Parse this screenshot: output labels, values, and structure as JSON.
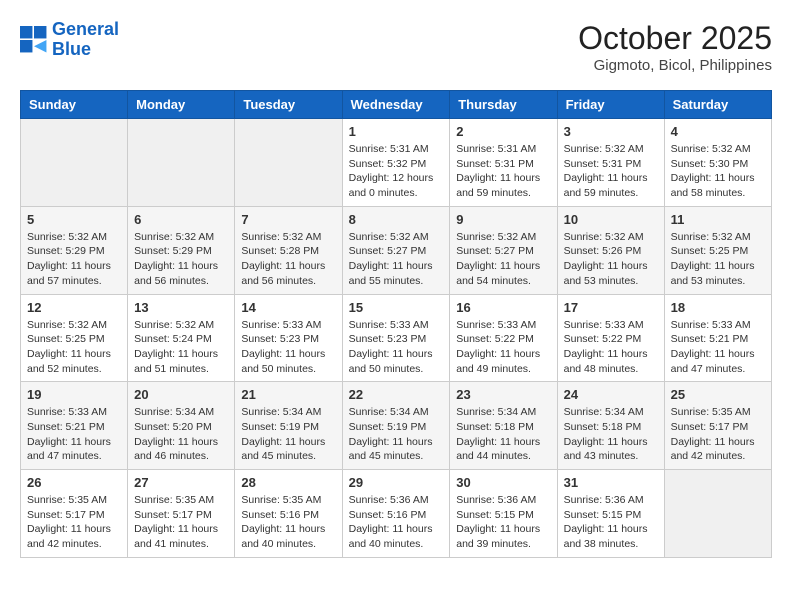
{
  "header": {
    "logo_line1": "General",
    "logo_line2": "Blue",
    "month": "October 2025",
    "location": "Gigmoto, Bicol, Philippines"
  },
  "weekdays": [
    "Sunday",
    "Monday",
    "Tuesday",
    "Wednesday",
    "Thursday",
    "Friday",
    "Saturday"
  ],
  "weeks": [
    [
      {
        "day": "",
        "info": ""
      },
      {
        "day": "",
        "info": ""
      },
      {
        "day": "",
        "info": ""
      },
      {
        "day": "1",
        "info": "Sunrise: 5:31 AM\nSunset: 5:32 PM\nDaylight: 12 hours and 0 minutes."
      },
      {
        "day": "2",
        "info": "Sunrise: 5:31 AM\nSunset: 5:31 PM\nDaylight: 11 hours and 59 minutes."
      },
      {
        "day": "3",
        "info": "Sunrise: 5:32 AM\nSunset: 5:31 PM\nDaylight: 11 hours and 59 minutes."
      },
      {
        "day": "4",
        "info": "Sunrise: 5:32 AM\nSunset: 5:30 PM\nDaylight: 11 hours and 58 minutes."
      }
    ],
    [
      {
        "day": "5",
        "info": "Sunrise: 5:32 AM\nSunset: 5:29 PM\nDaylight: 11 hours and 57 minutes."
      },
      {
        "day": "6",
        "info": "Sunrise: 5:32 AM\nSunset: 5:29 PM\nDaylight: 11 hours and 56 minutes."
      },
      {
        "day": "7",
        "info": "Sunrise: 5:32 AM\nSunset: 5:28 PM\nDaylight: 11 hours and 56 minutes."
      },
      {
        "day": "8",
        "info": "Sunrise: 5:32 AM\nSunset: 5:27 PM\nDaylight: 11 hours and 55 minutes."
      },
      {
        "day": "9",
        "info": "Sunrise: 5:32 AM\nSunset: 5:27 PM\nDaylight: 11 hours and 54 minutes."
      },
      {
        "day": "10",
        "info": "Sunrise: 5:32 AM\nSunset: 5:26 PM\nDaylight: 11 hours and 53 minutes."
      },
      {
        "day": "11",
        "info": "Sunrise: 5:32 AM\nSunset: 5:25 PM\nDaylight: 11 hours and 53 minutes."
      }
    ],
    [
      {
        "day": "12",
        "info": "Sunrise: 5:32 AM\nSunset: 5:25 PM\nDaylight: 11 hours and 52 minutes."
      },
      {
        "day": "13",
        "info": "Sunrise: 5:32 AM\nSunset: 5:24 PM\nDaylight: 11 hours and 51 minutes."
      },
      {
        "day": "14",
        "info": "Sunrise: 5:33 AM\nSunset: 5:23 PM\nDaylight: 11 hours and 50 minutes."
      },
      {
        "day": "15",
        "info": "Sunrise: 5:33 AM\nSunset: 5:23 PM\nDaylight: 11 hours and 50 minutes."
      },
      {
        "day": "16",
        "info": "Sunrise: 5:33 AM\nSunset: 5:22 PM\nDaylight: 11 hours and 49 minutes."
      },
      {
        "day": "17",
        "info": "Sunrise: 5:33 AM\nSunset: 5:22 PM\nDaylight: 11 hours and 48 minutes."
      },
      {
        "day": "18",
        "info": "Sunrise: 5:33 AM\nSunset: 5:21 PM\nDaylight: 11 hours and 47 minutes."
      }
    ],
    [
      {
        "day": "19",
        "info": "Sunrise: 5:33 AM\nSunset: 5:21 PM\nDaylight: 11 hours and 47 minutes."
      },
      {
        "day": "20",
        "info": "Sunrise: 5:34 AM\nSunset: 5:20 PM\nDaylight: 11 hours and 46 minutes."
      },
      {
        "day": "21",
        "info": "Sunrise: 5:34 AM\nSunset: 5:19 PM\nDaylight: 11 hours and 45 minutes."
      },
      {
        "day": "22",
        "info": "Sunrise: 5:34 AM\nSunset: 5:19 PM\nDaylight: 11 hours and 45 minutes."
      },
      {
        "day": "23",
        "info": "Sunrise: 5:34 AM\nSunset: 5:18 PM\nDaylight: 11 hours and 44 minutes."
      },
      {
        "day": "24",
        "info": "Sunrise: 5:34 AM\nSunset: 5:18 PM\nDaylight: 11 hours and 43 minutes."
      },
      {
        "day": "25",
        "info": "Sunrise: 5:35 AM\nSunset: 5:17 PM\nDaylight: 11 hours and 42 minutes."
      }
    ],
    [
      {
        "day": "26",
        "info": "Sunrise: 5:35 AM\nSunset: 5:17 PM\nDaylight: 11 hours and 42 minutes."
      },
      {
        "day": "27",
        "info": "Sunrise: 5:35 AM\nSunset: 5:17 PM\nDaylight: 11 hours and 41 minutes."
      },
      {
        "day": "28",
        "info": "Sunrise: 5:35 AM\nSunset: 5:16 PM\nDaylight: 11 hours and 40 minutes."
      },
      {
        "day": "29",
        "info": "Sunrise: 5:36 AM\nSunset: 5:16 PM\nDaylight: 11 hours and 40 minutes."
      },
      {
        "day": "30",
        "info": "Sunrise: 5:36 AM\nSunset: 5:15 PM\nDaylight: 11 hours and 39 minutes."
      },
      {
        "day": "31",
        "info": "Sunrise: 5:36 AM\nSunset: 5:15 PM\nDaylight: 11 hours and 38 minutes."
      },
      {
        "day": "",
        "info": ""
      }
    ]
  ]
}
